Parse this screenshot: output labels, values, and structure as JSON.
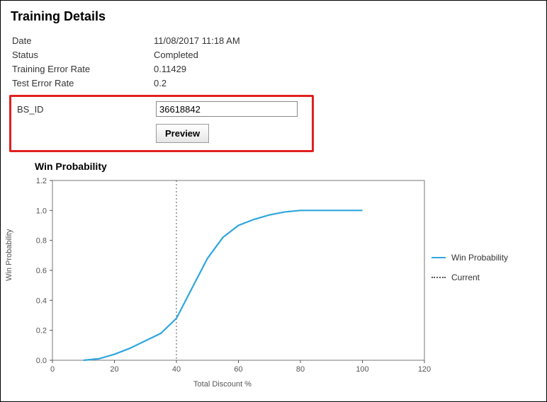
{
  "page": {
    "title": "Training Details"
  },
  "details": {
    "date_label": "Date",
    "date_value": "11/08/2017 11:18 AM",
    "status_label": "Status",
    "status_value": "Completed",
    "train_err_label": "Training Error Rate",
    "train_err_value": "0.11429",
    "test_err_label": "Test Error Rate",
    "test_err_value": "0.2"
  },
  "form": {
    "bsid_label": "BS_ID",
    "bsid_value": "36618842",
    "preview_label": "Preview"
  },
  "chart": {
    "title": "Win Probability",
    "ylabel": "Win Probability",
    "xlabel": "Total Discount %",
    "legend_series": "Win Probability",
    "legend_current": "Current"
  },
  "chart_data": {
    "type": "line",
    "title": "Win Probability",
    "xlabel": "Total Discount %",
    "ylabel": "Win Probability",
    "xlim": [
      0,
      120
    ],
    "ylim": [
      0,
      1.2
    ],
    "xticks": [
      0,
      20,
      40,
      60,
      80,
      100,
      120
    ],
    "yticks": [
      0,
      0.2,
      0.4,
      0.6,
      0.8,
      1.0,
      1.2
    ],
    "series": [
      {
        "name": "Win Probability",
        "x": [
          10,
          15,
          20,
          25,
          30,
          35,
          40,
          45,
          50,
          55,
          60,
          65,
          70,
          75,
          80,
          85,
          90,
          95,
          100
        ],
        "y": [
          0,
          0.01,
          0.04,
          0.08,
          0.13,
          0.18,
          0.28,
          0.48,
          0.68,
          0.82,
          0.9,
          0.94,
          0.97,
          0.99,
          1.0,
          1.0,
          1.0,
          1.0,
          1.0
        ]
      }
    ],
    "vlines": [
      {
        "name": "Current",
        "x": 40,
        "style": "dotted"
      }
    ]
  }
}
